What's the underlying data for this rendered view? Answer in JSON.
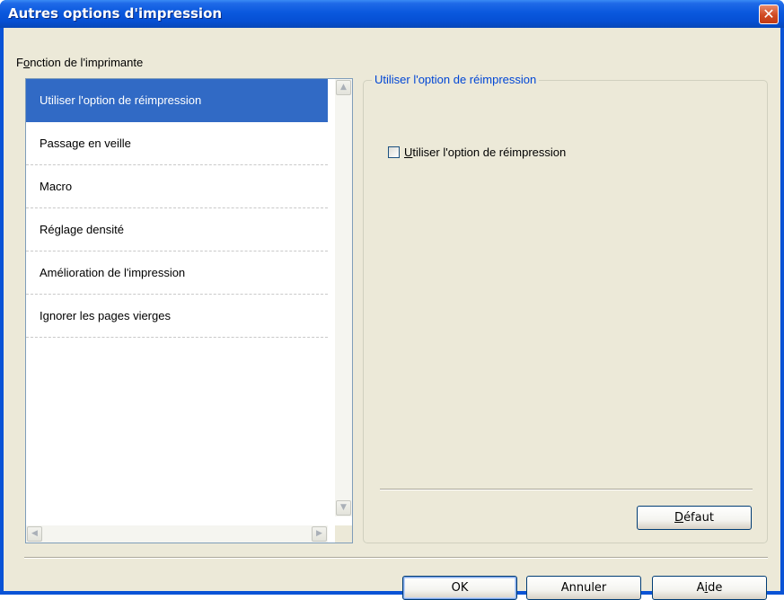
{
  "window": {
    "title": "Autres options d'impression",
    "close_glyph": "✕"
  },
  "section_label": {
    "prefix": "F",
    "underlined": "o",
    "rest": "nction de l'imprimante"
  },
  "function_list": {
    "items": [
      {
        "label": "Utiliser l'option de réimpression",
        "selected": true
      },
      {
        "label": "Passage en veille",
        "selected": false
      },
      {
        "label": "Macro",
        "selected": false
      },
      {
        "label": "Réglage densité",
        "selected": false
      },
      {
        "label": "Amélioration de l'impression",
        "selected": false
      },
      {
        "label": "Ignorer les pages vierges",
        "selected": false
      }
    ]
  },
  "groupbox": {
    "legend": "Utiliser l'option de réimpression",
    "checkbox": {
      "underlined": "U",
      "rest": "tiliser l'option de réimpression",
      "checked": false
    }
  },
  "buttons": {
    "default": {
      "underlined": "D",
      "rest": "éfaut"
    },
    "ok": "OK",
    "cancel": "Annuler",
    "help": {
      "prefix": "A",
      "underlined": "i",
      "rest": "de"
    }
  },
  "icons": {
    "scroll_up": "scroll-up-arrow-icon",
    "scroll_down": "scroll-down-arrow-icon",
    "scroll_left": "scroll-left-arrow-icon",
    "scroll_right": "scroll-right-arrow-icon",
    "close": "close-icon"
  },
  "colors": {
    "titlebar": "#0a58de",
    "selection": "#316ac5",
    "legend": "#0046d5",
    "dialog_bg": "#ece9d8"
  }
}
